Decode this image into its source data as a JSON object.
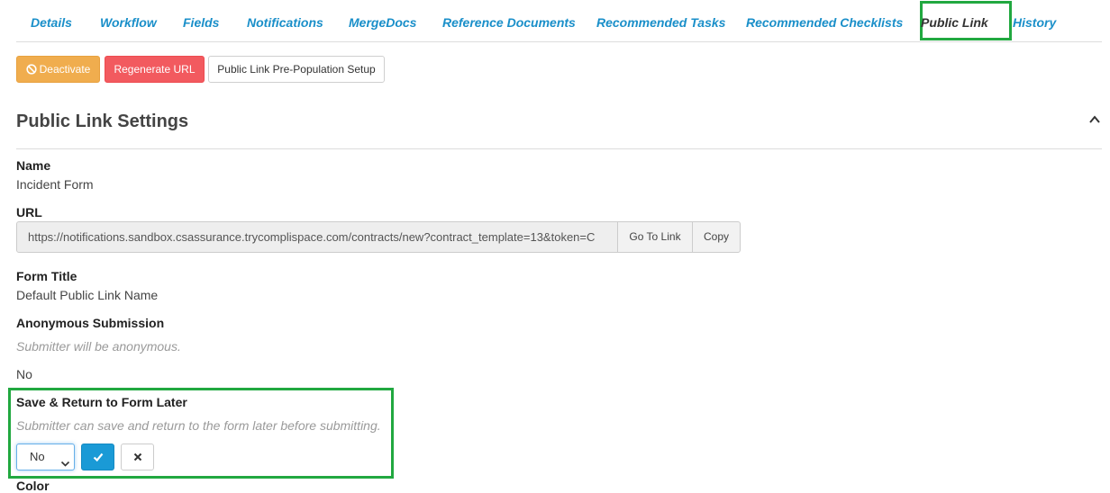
{
  "tabs": [
    {
      "label": "Details",
      "active": false
    },
    {
      "label": "Workflow",
      "active": false
    },
    {
      "label": "Fields",
      "active": false
    },
    {
      "label": "Notifications",
      "active": false
    },
    {
      "label": "MergeDocs",
      "active": false
    },
    {
      "label": "Reference Documents",
      "active": false
    },
    {
      "label": "Recommended Tasks",
      "active": false
    },
    {
      "label": "Recommended Checklists",
      "active": false
    },
    {
      "label": "Public Link",
      "active": true
    },
    {
      "label": "History",
      "active": false
    }
  ],
  "actions": {
    "deactivate_label": "Deactivate",
    "regenerate_label": "Regenerate URL",
    "prepopulation_label": "Public Link Pre-Population Setup"
  },
  "settings": {
    "title": "Public Link Settings",
    "name_label": "Name",
    "name_value": "Incident Form",
    "url_label": "URL",
    "url_value": "https://notifications.sandbox.csassurance.trycomplispace.com/contracts/new?contract_template=13&token=C",
    "go_to_link_label": "Go To Link",
    "copy_label": "Copy",
    "form_title_label": "Form Title",
    "form_title_value": "Default Public Link Name",
    "anonymous_label": "Anonymous Submission",
    "anonymous_hint": "Submitter will be anonymous.",
    "anonymous_value": "No",
    "save_return_label": "Save & Return to Form Later",
    "save_return_hint": "Submitter can save and return to the form later before submitting.",
    "save_return_selected": "No",
    "next_label": "Color"
  },
  "colors": {
    "tab_link": "#1a8fc9",
    "highlight": "#21a840",
    "deactivate": "#f0ad4e",
    "regenerate": "#f25a5f",
    "confirm": "#1a9ad6"
  },
  "icons": {
    "deactivate": "ban-icon",
    "collapse": "chevron-up-icon",
    "select": "chevron-down-icon",
    "confirm": "check-icon",
    "cancel": "close-icon"
  }
}
